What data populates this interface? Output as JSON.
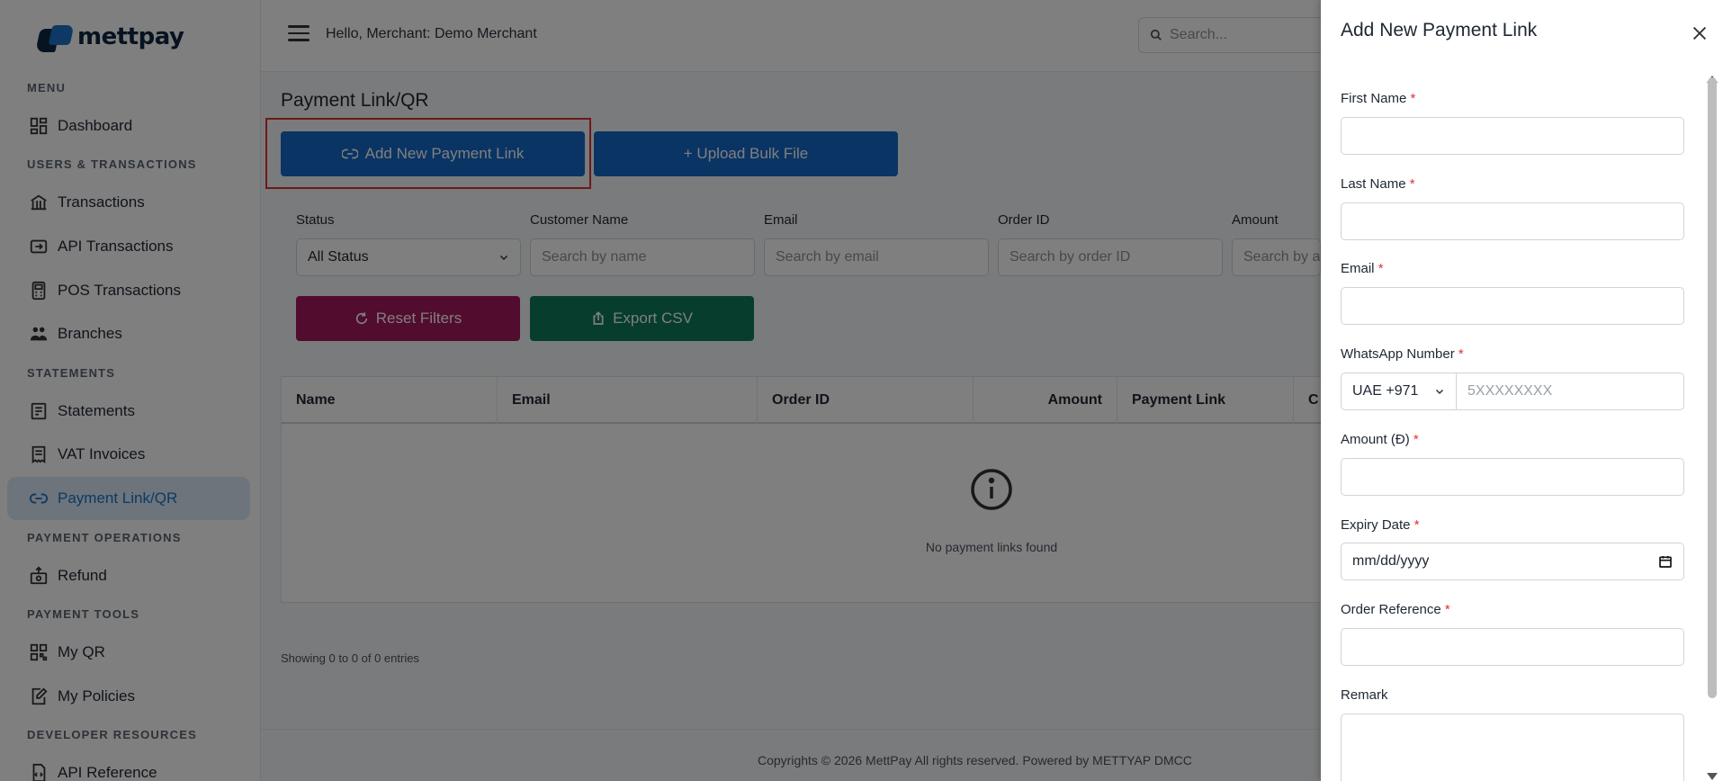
{
  "brand": {
    "name": "mettpay"
  },
  "sidebar": {
    "sections": {
      "menu": "MENU",
      "users": "USERS & TRANSACTIONS",
      "statements": "STATEMENTS",
      "payment_ops": "PAYMENT OPERATIONS",
      "payment_tools": "PAYMENT TOOLS",
      "developer": "DEVELOPER RESOURCES"
    },
    "items": {
      "dashboard": "Dashboard",
      "transactions": "Transactions",
      "api_transactions": "API Transactions",
      "pos_transactions": "POS Transactions",
      "branches": "Branches",
      "statements": "Statements",
      "vat_invoices": "VAT Invoices",
      "payment_link": "Payment Link/QR",
      "refund": "Refund",
      "my_qr": "My QR",
      "my_policies": "My Policies",
      "api_reference": "API Reference"
    }
  },
  "header": {
    "greeting": "Hello, Merchant: Demo Merchant",
    "search_placeholder": "Search..."
  },
  "main": {
    "title": "Payment Link/QR",
    "add_button": "Add New Payment Link",
    "upload_button": "+ Upload Bulk File",
    "filters": {
      "status_label": "Status",
      "status_value": "All Status",
      "customer_label": "Customer Name",
      "customer_placeholder": "Search by name",
      "email_label": "Email",
      "email_placeholder": "Search by email",
      "order_label": "Order ID",
      "order_placeholder": "Search by order ID",
      "amount_label": "Amount",
      "amount_placeholder": "Search by a"
    },
    "reset_button": "Reset Filters",
    "export_button": "Export CSV",
    "table": {
      "columns": [
        "Name",
        "Email",
        "Order ID",
        "Amount",
        "Payment Link",
        "C"
      ],
      "empty_text": "No payment links found"
    },
    "showing": "Showing 0 to 0 of 0 entries"
  },
  "footer": {
    "text": "Copyrights © 2026 MettPay All rights reserved. Powered by METTYAP DMCC"
  },
  "drawer": {
    "title": "Add New Payment Link",
    "first_name": "First Name",
    "last_name": "Last Name",
    "email": "Email",
    "whatsapp": "WhatsApp Number",
    "country_code": "UAE +971",
    "phone_placeholder": "5XXXXXXXX",
    "amount": "Amount (Đ)",
    "expiry": "Expiry Date",
    "expiry_placeholder": "mm/dd/yyyy",
    "order_ref": "Order Reference",
    "remark": "Remark",
    "required_mark": "*"
  },
  "colors": {
    "primary": "#1468c8",
    "maroon": "#a5195b",
    "green": "#0e7a5a",
    "required": "#e03131"
  }
}
